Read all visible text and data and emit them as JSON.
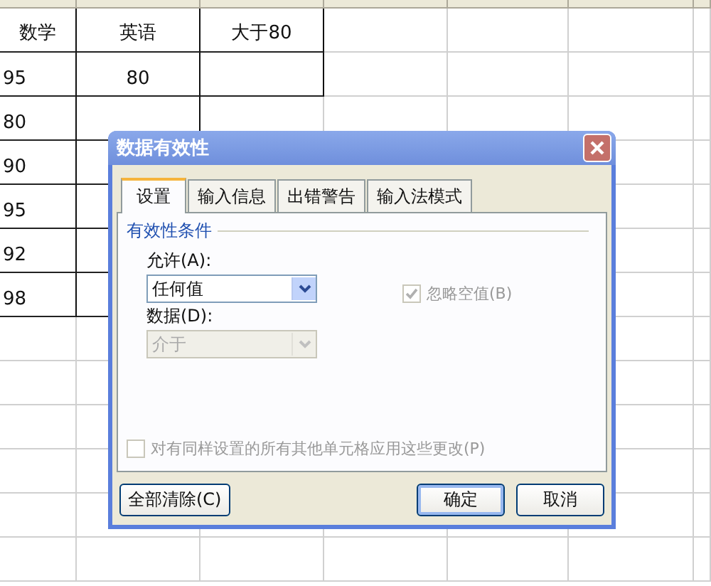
{
  "sheet": {
    "rows": [
      [
        "数学",
        "英语",
        "大于80"
      ],
      [
        "95",
        "80",
        ""
      ],
      [
        "80",
        "",
        ""
      ],
      [
        "90",
        "",
        ""
      ],
      [
        "95",
        "",
        ""
      ],
      [
        "92",
        "",
        ""
      ],
      [
        "98",
        "",
        ""
      ]
    ]
  },
  "dialog": {
    "title": "数据有效性",
    "tabs": [
      {
        "label": "设置",
        "selected": true
      },
      {
        "label": "输入信息",
        "selected": false
      },
      {
        "label": "出错警告",
        "selected": false
      },
      {
        "label": "输入法模式",
        "selected": false
      }
    ],
    "group_title": "有效性条件",
    "allow": {
      "label": "允许(A):",
      "value": "任何值",
      "disabled": false
    },
    "data": {
      "label": "数据(D):",
      "value": "介于",
      "disabled": true
    },
    "ignore_blank": {
      "label": "忽略空值(B)",
      "checked": true,
      "disabled": true
    },
    "apply_all": {
      "label": "对有同样设置的所有其他单元格应用这些更改(P)",
      "checked": false,
      "disabled": true
    },
    "buttons": [
      {
        "label": "全部清除(C)",
        "kind": "left"
      },
      {
        "label": "确定",
        "kind": "default"
      },
      {
        "label": "取消",
        "kind": "normal"
      }
    ]
  }
}
